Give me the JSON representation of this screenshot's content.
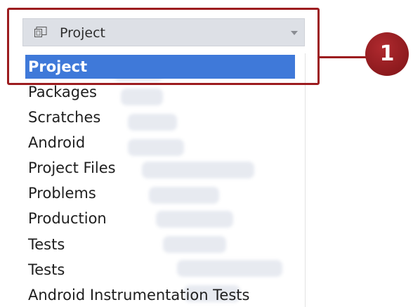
{
  "dropdown": {
    "selected_label": "Project"
  },
  "list": {
    "items": [
      {
        "label": "Project"
      },
      {
        "label": "Packages"
      },
      {
        "label": "Scratches"
      },
      {
        "label": "Android"
      },
      {
        "label": "Project Files"
      },
      {
        "label": "Problems"
      },
      {
        "label": "Production"
      },
      {
        "label": "Tests"
      },
      {
        "label": "Tests"
      },
      {
        "label": "Android Instrumentation Tests"
      }
    ]
  },
  "callout": {
    "number": "1"
  },
  "colors": {
    "selection": "#3f79d9",
    "annotation": "#9c1c1f",
    "header_bg": "#dde0e6"
  },
  "icons": {
    "view_icon": "project-view-icon",
    "dropdown_arrow": "chevron-down-icon"
  }
}
